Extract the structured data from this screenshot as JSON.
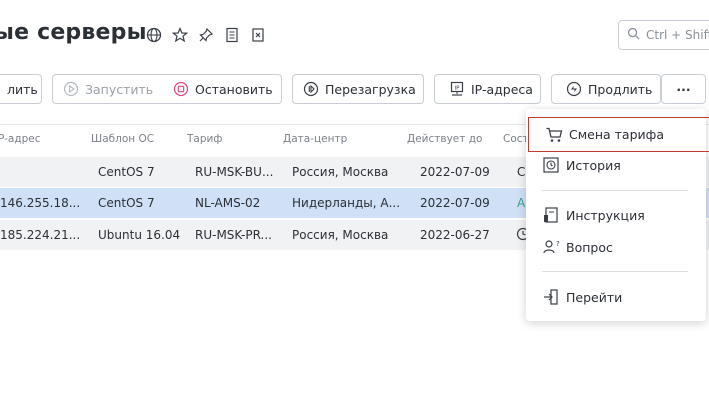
{
  "page": {
    "title": "ые серверы"
  },
  "title_icons": [
    "globe-icon",
    "star-icon",
    "pin-icon",
    "notes-icon",
    "export-icon"
  ],
  "search": {
    "placeholder": "Ctrl + Shift"
  },
  "toolbar": {
    "delete_label": "лить",
    "start_label": "Запустить",
    "stop_label": "Остановить",
    "reboot_label": "Перезагрузка",
    "ip_label": "IP-адреса",
    "extend_label": "Продлить",
    "more_label": "···"
  },
  "table": {
    "headers": [
      "P-адрес",
      "Шаблон ОС",
      "Тариф",
      "Дата-центр",
      "Действует до",
      "Сост"
    ],
    "rows": [
      {
        "ip": "",
        "os": "CentOS 7",
        "tariff": "RU-MSK-BU...",
        "dc": "Россия, Москва",
        "until": "2022-07-09",
        "status": "С"
      },
      {
        "ip": "146.255.18...",
        "os": "CentOS 7",
        "tariff": "NL-AMS-02",
        "dc": "Нидерланды, А...",
        "until": "2022-07-09",
        "status": "А"
      },
      {
        "ip": "185.224.21...",
        "os": "Ubuntu 16.04",
        "tariff": "RU-MSK-PR...",
        "dc": "Россия, Москва",
        "until": "2022-06-27",
        "status": ""
      }
    ]
  },
  "menu": {
    "items": [
      {
        "label": "Смена тарифа",
        "icon": "cart-icon"
      },
      {
        "label": "История",
        "icon": "history-icon"
      },
      {
        "label": "Инструкция",
        "icon": "instruction-icon"
      },
      {
        "label": "Вопрос",
        "icon": "question-icon"
      },
      {
        "label": "Перейти",
        "icon": "go-icon"
      }
    ]
  },
  "colors": {
    "selected_row": "#cfe0f7",
    "row_bg": "#f1f2f4",
    "active_item_border": "#c0392b",
    "accent_pink": "#e0457b"
  }
}
